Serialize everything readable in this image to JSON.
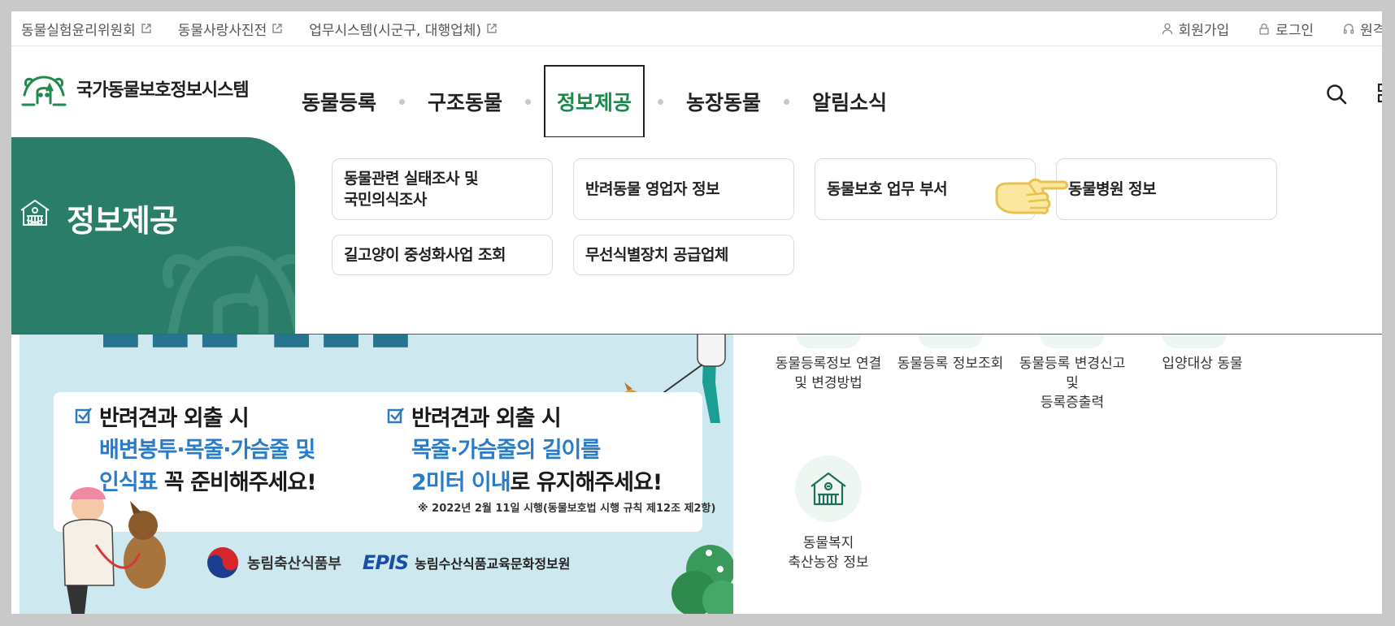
{
  "util": {
    "links": [
      "동물실험윤리위원회",
      "동물사랑사진전",
      "업무시스템(시군구, 대행업체)"
    ],
    "signup": "회원가입",
    "login": "로그인",
    "remote": "원격지"
  },
  "header": {
    "logo_text": "국가동물보호정보시스템",
    "menu": [
      "동물등록",
      "구조동물",
      "정보제공",
      "농장동물",
      "알림소식"
    ],
    "active_menu_index": 2
  },
  "mega": {
    "title": "정보제공",
    "items": [
      {
        "line1": "동물관련 실태조사 및",
        "line2": "국민의식조사"
      },
      {
        "line1": "반려동물 영업자 정보",
        "line2": ""
      },
      {
        "line1": "동물보호 업무 부서",
        "line2": ""
      },
      {
        "line1": "동물병원 정보",
        "line2": ""
      },
      {
        "line1": "길고양이 중성화사업 조회",
        "line2": ""
      },
      {
        "line1": "무선식별장치 공급업체",
        "line2": ""
      }
    ]
  },
  "banner": {
    "col1": {
      "head": "반려견과 외출 시",
      "line2": "배변봉투·목줄·가슴줄 및",
      "line3_blue": "인식표",
      "line3_dark": " 꼭 준비해주세요!"
    },
    "col2": {
      "head": "반려견과 외출 시",
      "line2": "목줄·가슴줄의 길이를",
      "line3_blue": "2미터 이내",
      "line3_dark": "로 유지해주세요!"
    },
    "note": "※ 2022년 2월 11일 시행(동물보호법 시행 규칙 제12조 제2항)",
    "org1": "농림축산식품부",
    "org2_mark": "EPIS",
    "org2": "농림수산식품교육문화정보원"
  },
  "quick": {
    "items": [
      {
        "l1": "동물등록정보 연결",
        "l2": "및 변경방법",
        "l3": ""
      },
      {
        "l1": "동물등록 정보조회",
        "l2": "",
        "l3": ""
      },
      {
        "l1": "동물등록 변경신고",
        "l2": "및",
        "l3": "등록증출력"
      },
      {
        "l1": "입양대상 동물",
        "l2": "",
        "l3": ""
      },
      {
        "l1": "동물복지",
        "l2": "축산농장 정보",
        "l3": ""
      }
    ]
  },
  "colors": {
    "brand_green": "#2a7d68",
    "active_green": "#1a8a4c",
    "banner_blue": "#2c7bc5"
  }
}
